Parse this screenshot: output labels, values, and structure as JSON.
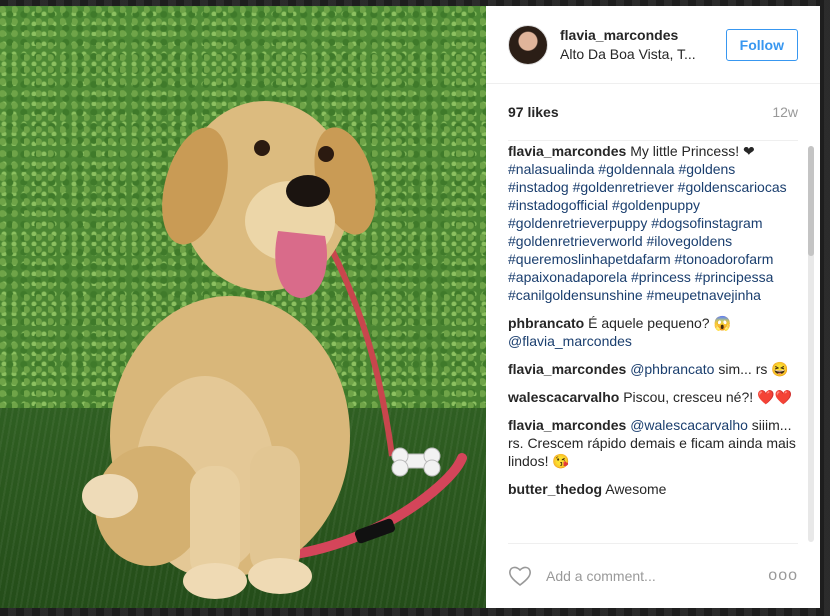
{
  "post": {
    "username": "flavia_marcondes",
    "location": "Alto Da Boa Vista, T...",
    "follow_label": "Follow",
    "likes": "97 likes",
    "age": "12w"
  },
  "comments": [
    {
      "user": "flavia_marcondes",
      "text": "My little Princess! ❤",
      "tags": "#nalasualinda #goldennala #goldens #instadog #goldenretriever #goldenscariocas #instadogofficial #goldenpuppy #goldenretrieverpuppy #dogsofinstagram #goldenretrieverworld #ilovegoldens #queremoslinhapetdafarm #tonoadorofarm #apaixonadaporela #princess #principessa #canilgoldensunshine #meupetnavejinha"
    },
    {
      "user": "phbrancato",
      "text": "É aquele pequeno? 😱",
      "mention": "@flavia_marcondes"
    },
    {
      "user": "flavia_marcondes",
      "mention": "@phbrancato",
      "text": "sim... rs 😆"
    },
    {
      "user": "walescacarvalho",
      "text": "Piscou, cresceu né?! ❤️❤️"
    },
    {
      "user": "flavia_marcondes",
      "mention": "@walescacarvalho",
      "text": "siiim... rs. Crescem rápido demais e ficam ainda mais lindos! 😘"
    },
    {
      "user": "butter_thedog",
      "text": "Awesome"
    }
  ],
  "footer": {
    "placeholder": "Add a comment...",
    "more_label": "ooo"
  },
  "icons": {
    "heart": "heart-outline-icon",
    "more": "more-options-icon"
  },
  "colors": {
    "accent": "#3897f0",
    "text": "#262626",
    "muted": "#999999",
    "hashtag": "#1a3e6e"
  }
}
